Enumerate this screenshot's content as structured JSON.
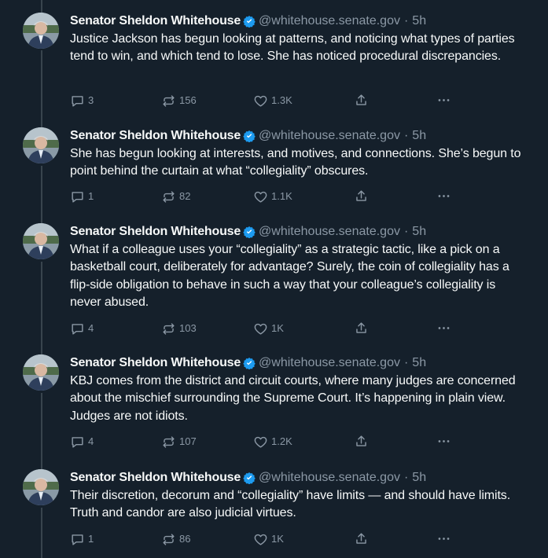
{
  "author": {
    "name": "Senator Sheldon Whitehouse",
    "handle": "@whitehouse.senate.gov",
    "separator": "·",
    "verified_icon": "verified-badge-icon"
  },
  "colors": {
    "background": "#15202b",
    "text": "#f7f9f9",
    "muted": "#8b98a5",
    "verified": "#1d9bf0",
    "thread_line": "#38444d"
  },
  "posts": [
    {
      "time": "5h",
      "text": "Justice Jackson has begun looking at patterns, and noticing what types of parties tend to win, and which tend to lose. She has noticed procedural discrepancies.",
      "replies": "3",
      "reposts": "156",
      "likes": "1.3K"
    },
    {
      "time": "5h",
      "text": "She has begun looking at interests, and motives, and connections. She’s begun to point behind the curtain at what “collegiality” obscures.",
      "replies": "1",
      "reposts": "82",
      "likes": "1.1K"
    },
    {
      "time": "5h",
      "text": "What if a colleague uses your “collegiality” as a strategic tactic, like a pick on a basketball court, deliberately for advantage? Surely, the coin of collegiality has a flip-side obligation to behave in such a way that your colleague’s collegiality is never abused.",
      "replies": "4",
      "reposts": "103",
      "likes": "1K"
    },
    {
      "time": "5h",
      "text": "KBJ comes from the district and circuit courts, where many judges are concerned about the mischief surrounding the Supreme Court. It’s happening in plain view. Judges are not idiots.",
      "replies": "4",
      "reposts": "107",
      "likes": "1.2K"
    },
    {
      "time": "5h",
      "text": "Their discretion, decorum and “collegiality” have limits — and should have limits. Truth and candor are also judicial virtues.",
      "replies": "1",
      "reposts": "86",
      "likes": "1K"
    }
  ]
}
